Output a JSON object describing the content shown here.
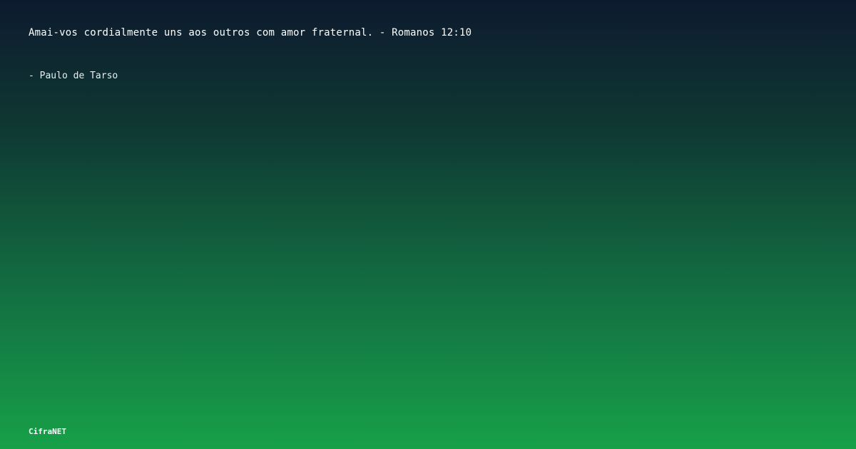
{
  "quote": {
    "text": "Amai-vos cordialmente uns aos outros com amor fraternal. - Romanos 12:10",
    "author": "- Paulo de Tarso"
  },
  "brand": {
    "name": "CifraNET"
  },
  "colors": {
    "gradient_top": "#0d1a2e",
    "gradient_bottom": "#17a048",
    "text": "#ffffff"
  }
}
